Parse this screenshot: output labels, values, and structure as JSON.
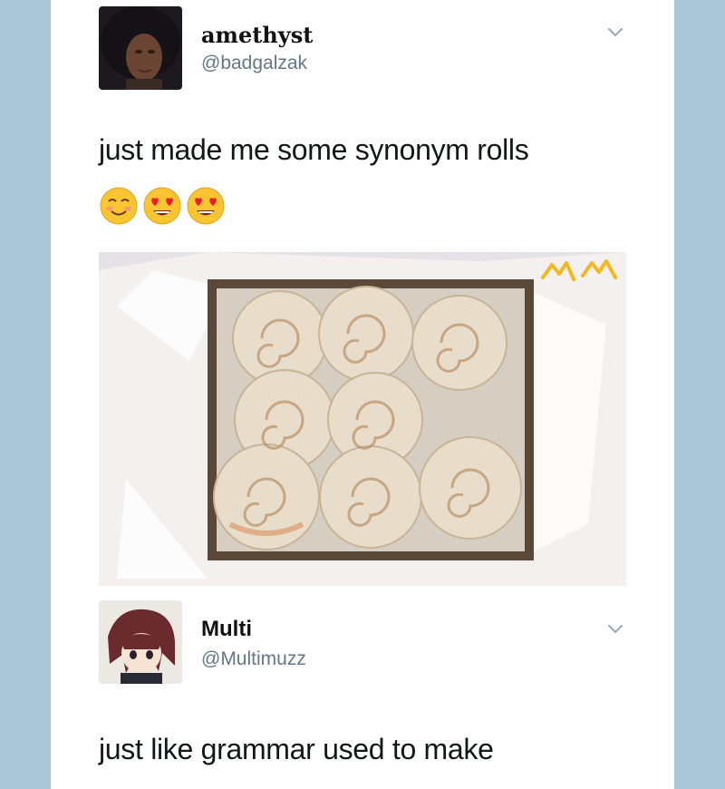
{
  "tweet1": {
    "display_name": "amethyst",
    "handle": "@badgalzak",
    "text": "just made me some synonym rolls",
    "emojis": [
      "smiling-blush-icon",
      "heart-eyes-icon",
      "heart-eyes-icon"
    ],
    "photo_caption_mark": "MM"
  },
  "tweet2": {
    "display_name": "Multi",
    "handle": "@Multimuzz",
    "text": "just like grammar used to make"
  },
  "colors": {
    "background": "#a9c6d6",
    "card": "#ffffff",
    "handle": "#657786",
    "text": "#14171a"
  }
}
